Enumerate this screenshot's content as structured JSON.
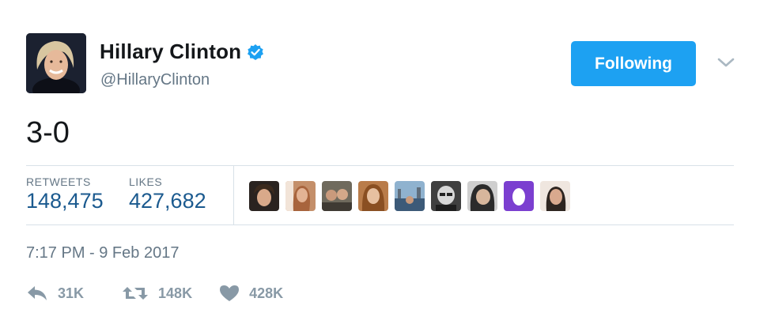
{
  "author": {
    "name": "Hillary Clinton",
    "handle": "@HillaryClinton",
    "verified_icon": "verified-badge-icon"
  },
  "follow_button": {
    "label": "Following",
    "color": "#1da1f2"
  },
  "menu_icon": "chevron-down-icon",
  "tweet": {
    "text": "3-0"
  },
  "stats": {
    "retweets_label": "RETWEETS",
    "retweets_value": "148,475",
    "likes_label": "LIKES",
    "likes_value": "427,682"
  },
  "liker_avatars_count": 9,
  "timestamp": "7:17 PM - 9 Feb 2017",
  "actions": {
    "reply": {
      "icon": "reply-icon",
      "count": "31K"
    },
    "retweet": {
      "icon": "retweet-icon",
      "count": "148K"
    },
    "like": {
      "icon": "heart-icon",
      "count": "428K"
    }
  }
}
